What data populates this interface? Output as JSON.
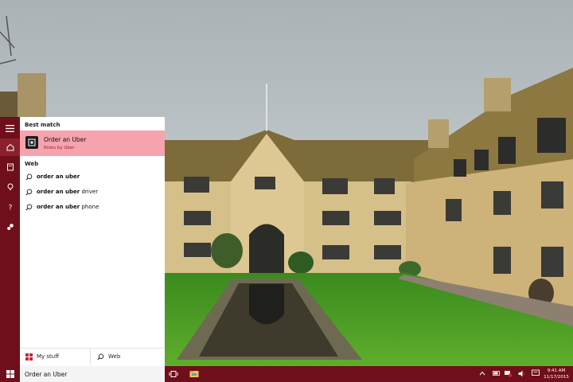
{
  "search": {
    "query": "Order an Uber",
    "best_match_heading": "Best match",
    "best_match": {
      "title": "Order an Uber",
      "subtitle": "Rides by Uber"
    },
    "web_heading": "Web",
    "suggestions": [
      {
        "bold": "order an uber",
        "rest": ""
      },
      {
        "bold": "order an uber",
        "rest": " driver"
      },
      {
        "bold": "order an uber",
        "rest": " phone"
      }
    ],
    "scope_my_stuff": "My stuff",
    "scope_web": "Web"
  },
  "rail_icons": [
    "hamburger-icon",
    "home-icon",
    "notebook-icon",
    "lightbulb-icon",
    "help-icon",
    "feedback-icon"
  ],
  "taskbar": {
    "time": "9:41 AM",
    "date": "11/17/2015",
    "accent": "#6f0f1b"
  },
  "colors": {
    "highlight": "#f5a3ad",
    "subtitle": "#a3212e"
  }
}
